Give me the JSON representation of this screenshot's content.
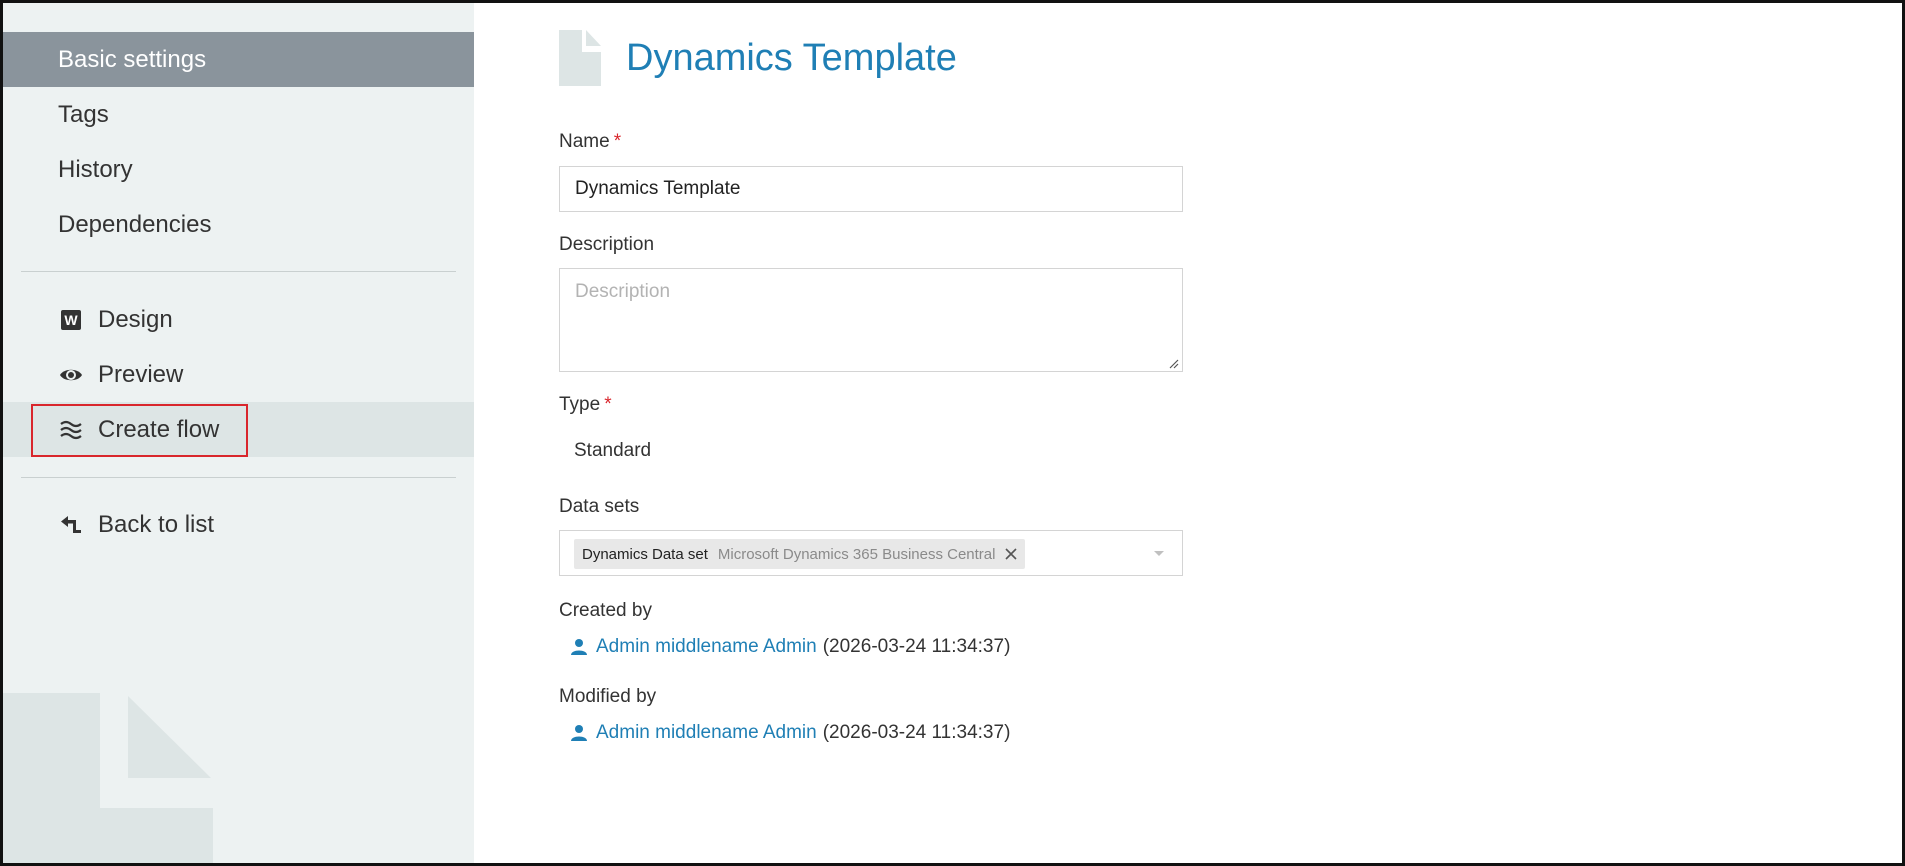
{
  "sidebar": {
    "items": [
      {
        "label": "Basic settings"
      },
      {
        "label": "Tags"
      },
      {
        "label": "History"
      },
      {
        "label": "Dependencies"
      }
    ],
    "actions": [
      {
        "label": "Design",
        "icon": "word-icon"
      },
      {
        "label": "Preview",
        "icon": "eye-icon"
      },
      {
        "label": "Create flow",
        "icon": "approx-icon"
      }
    ],
    "back": {
      "label": "Back to list",
      "icon": "back-arrow-icon"
    }
  },
  "main": {
    "title": "Dynamics Template",
    "name": {
      "label": "Name",
      "required": "*",
      "value": "Dynamics Template"
    },
    "description": {
      "label": "Description",
      "placeholder": "Description",
      "value": ""
    },
    "type": {
      "label": "Type",
      "required": "*",
      "value": "Standard"
    },
    "datasets": {
      "label": "Data sets",
      "selected": [
        {
          "name": "Dynamics Data set",
          "source": "Microsoft Dynamics 365 Business Central"
        }
      ]
    },
    "created": {
      "label": "Created by",
      "user": "Admin middlename Admin",
      "timestamp": "(2026-03-24 11:34:37)"
    },
    "modified": {
      "label": "Modified by",
      "user": "Admin middlename Admin",
      "timestamp": "(2026-03-24 11:34:37)"
    }
  },
  "colors": {
    "accent": "#1f7fb5",
    "sidebar_bg": "#edf2f2",
    "active_bg": "#8a949c",
    "required": "#d9262c",
    "highlight": "#d9262c"
  }
}
